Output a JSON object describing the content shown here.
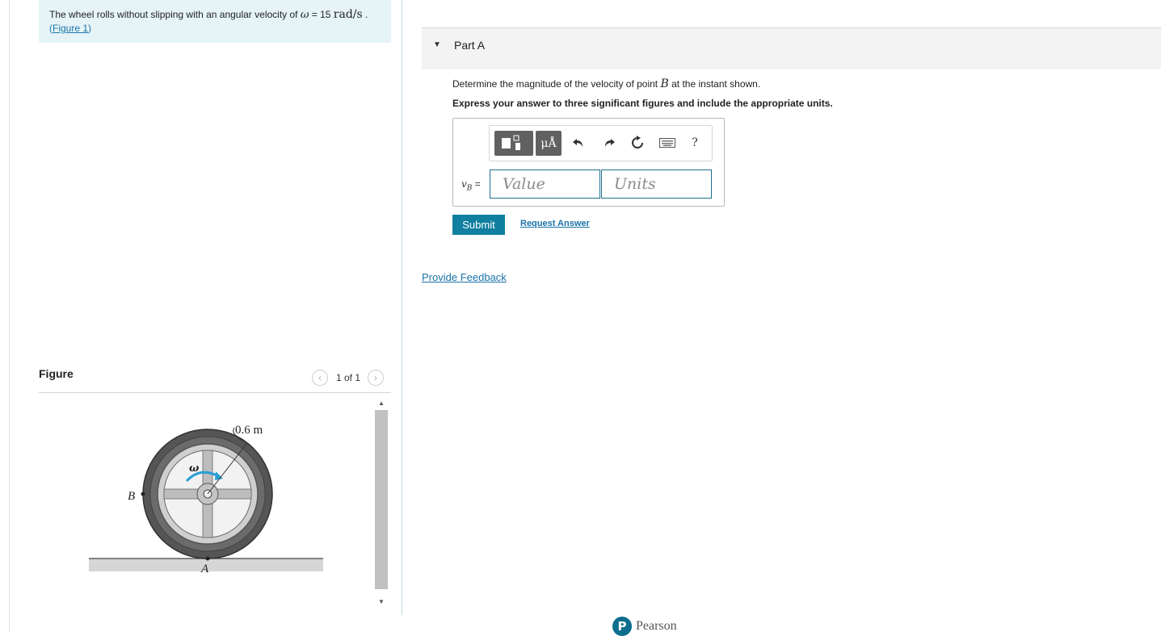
{
  "problem": {
    "text_before": "The wheel rolls without slipping with an angular velocity of ",
    "omega_symbol": "ω",
    "equals_value": " = 15 ",
    "units": "rad/s",
    "period": " .",
    "figure_link_open": "(",
    "figure_link": "Figure 1",
    "figure_link_close": ")"
  },
  "figure_panel": {
    "title": "Figure",
    "prev_icon": "chevron-left-icon",
    "next_icon": "chevron-right-icon",
    "page_indicator": "1 of 1",
    "labels": {
      "radius": "0.6 m",
      "omega": "ω",
      "point_b": "B",
      "point_a": "A"
    }
  },
  "part": {
    "title": "Part A",
    "question_before": "Determine the magnitude of the velocity of point ",
    "question_point": "B",
    "question_after": " at the instant shown.",
    "instruction": "Express your answer to three significant figures and include the appropriate units.",
    "toolbar": {
      "units_label": "μÅ",
      "icons": [
        "templates-icon",
        "units-icon",
        "undo-icon",
        "redo-icon",
        "reset-icon",
        "keyboard-icon",
        "help-icon"
      ],
      "help_label": "?"
    },
    "answer_label_var": "v",
    "answer_label_sub": "B",
    "answer_label_eq": " =",
    "value_placeholder": "Value",
    "units_placeholder": "Units",
    "submit_label": "Submit",
    "request_answer_label": "Request Answer"
  },
  "feedback_link": "Provide Feedback",
  "footer": {
    "brand": "Pearson",
    "logo_letter": "P"
  },
  "colors": {
    "accent": "#107fa0",
    "link": "#1a73a8",
    "problem_bg": "#e6f4f7"
  }
}
